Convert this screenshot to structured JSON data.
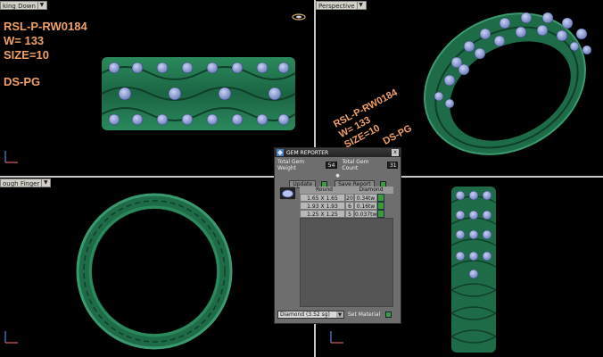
{
  "viewports": {
    "top_left": {
      "label": "king Down"
    },
    "top_right": {
      "label": "Perspective"
    },
    "bottom_left": {
      "label": "ough Finger"
    }
  },
  "annotation": {
    "line1": "RSL-P-RW0184",
    "line2": "W= 133",
    "line3": "SIZE=10",
    "line4": "DS-PG"
  },
  "annotation_rotated": {
    "line1": "RSL-P-RW0184",
    "line2": "W= 133",
    "line3": "SIZE=10",
    "line4": "DS-PG"
  },
  "colors": {
    "metal": "#1e6b48",
    "metal_light": "#3a9a6e",
    "gem": "#8fa0d8",
    "annotation": "#f0a064"
  },
  "gem_reporter": {
    "title": "GEM REPORTER",
    "close_label": "x",
    "total_weight_label": "Total Gem Weight",
    "total_weight_value": "54",
    "total_count_label": "Total Gem Count",
    "total_count_value": "31",
    "update_label": "Update",
    "save_label": "Save Report",
    "shape_header": "Round",
    "material_header": "Diamond",
    "rows": [
      {
        "size": "1.65 X 1.65",
        "count": "20",
        "weight": "0.34tw"
      },
      {
        "size": "1.93 X 1.93",
        "count": "6",
        "weight": "0.16tw"
      },
      {
        "size": "1.25 X 1.25",
        "count": "5",
        "weight": "0.037tw"
      }
    ],
    "material_select": "Diamond   (3.52 sg)",
    "set_material_label": "Set Material"
  }
}
